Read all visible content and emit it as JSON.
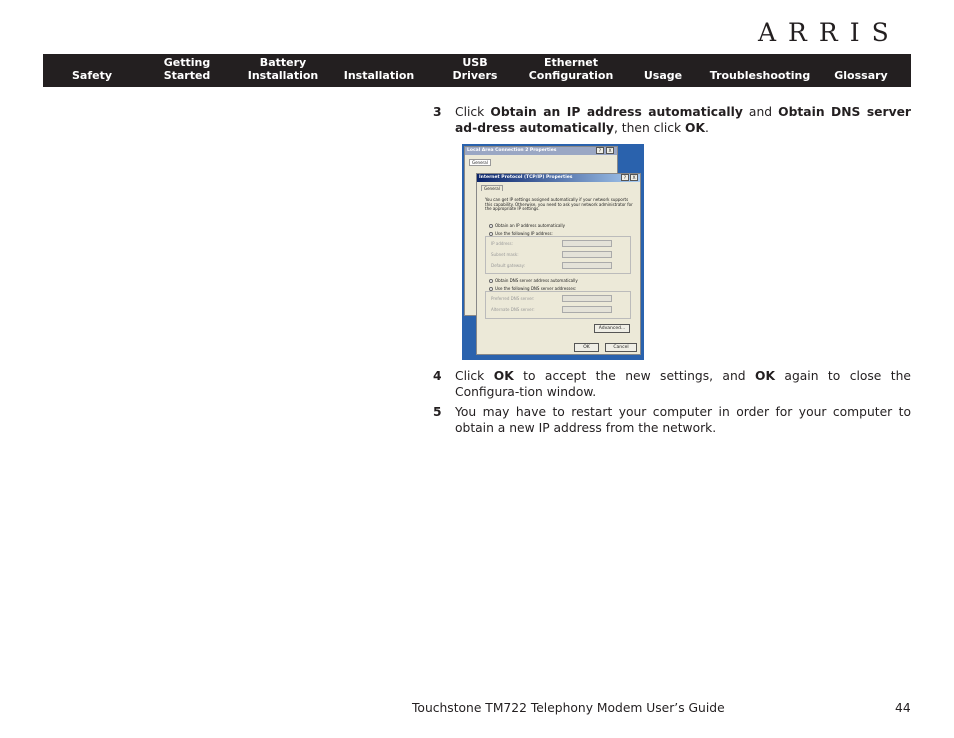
{
  "header": {
    "logo": "ARRIS"
  },
  "nav": {
    "items": [
      "Safety",
      "Getting\nStarted",
      "Battery\nInstallation",
      "Installation",
      "USB\nDrivers",
      "Ethernet\nConfiguration",
      "Usage",
      "Troubleshooting",
      "Glossary"
    ]
  },
  "steps": [
    {
      "num": "3",
      "parts": [
        [
          "Click ",
          false
        ],
        [
          "Obtain an IP address automatically",
          true
        ],
        [
          " and ",
          false
        ],
        [
          "Obtain DNS server ad-dress automatically",
          true
        ],
        [
          ", then click ",
          false
        ],
        [
          "OK",
          true
        ],
        [
          ".",
          false
        ]
      ]
    },
    {
      "num": "4",
      "parts": [
        [
          "Click ",
          false
        ],
        [
          "OK",
          true
        ],
        [
          " to accept the new settings, and ",
          false
        ],
        [
          "OK",
          true
        ],
        [
          " again to close the Configura-tion window.",
          false
        ]
      ]
    },
    {
      "num": "5",
      "parts": [
        [
          "You may have to restart your computer in order for your computer to obtain a new IP address from the network.",
          false
        ]
      ]
    }
  ],
  "screenshot": {
    "back_title": "Local Area Connection 2 Properties",
    "front_title": "Internet Protocol (TCP/IP) Properties",
    "tab": "General",
    "intro": "You can get IP settings assigned automatically if your network supports this capability. Otherwise, you need to ask your network administrator for the appropriate IP settings.",
    "radio_ip_auto": "Obtain an IP address automatically",
    "radio_ip_manual": "Use the following IP address:",
    "ip_address": "IP address:",
    "subnet": "Subnet mask:",
    "gateway": "Default gateway:",
    "radio_dns_auto": "Obtain DNS server address automatically",
    "radio_dns_manual": "Use the following DNS server addresses:",
    "pref_dns": "Preferred DNS server:",
    "alt_dns": "Alternate DNS server:",
    "advanced": "Advanced...",
    "ok": "OK",
    "cancel": "Cancel",
    "help": "?",
    "close": "X"
  },
  "footer": {
    "title": "Touchstone TM722 Telephony Modem User’s Guide",
    "page": "44"
  }
}
